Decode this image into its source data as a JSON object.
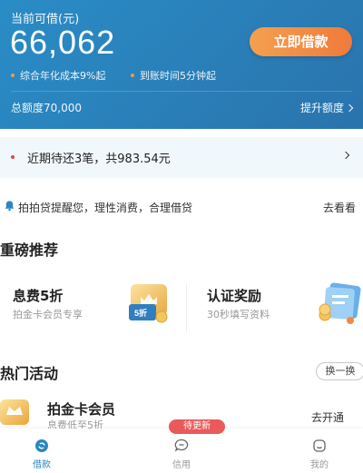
{
  "header": {
    "available_label": "当前可借(元)",
    "available_amount": "66,062",
    "borrow_button": "立即借款",
    "notes": [
      "综合年化成本9%起",
      "到账时间5分钟起"
    ],
    "total_quota": "总额度70,000",
    "raise_quota": "提升额度"
  },
  "repayment": {
    "text": "近期待还3笔，共983.54元"
  },
  "notice": {
    "text": "拍拍贷提醒您，理性消费，合理借贷",
    "action": "去看看"
  },
  "featured": {
    "title": "重磅推荐",
    "cards": [
      {
        "title": "息费5折",
        "subtitle": "拍金卡会员专享",
        "badge": "5折"
      },
      {
        "title": "认证奖励",
        "subtitle": "30秒填写资料"
      }
    ]
  },
  "hot": {
    "title": "热门活动",
    "swap_label": "换一换",
    "item": {
      "title": "拍金卡会员",
      "subtitle": "息费低至5折",
      "action": "去开通"
    }
  },
  "tabbar": {
    "badge": "待更新",
    "tabs": [
      {
        "label": "借款",
        "icon": "loan-icon",
        "active": true
      },
      {
        "label": "信用",
        "icon": "credit-icon",
        "active": false
      },
      {
        "label": "我的",
        "icon": "profile-icon",
        "active": false
      }
    ]
  },
  "colors": {
    "primary": "#2a86c2",
    "accent_orange": "#f28a3f",
    "alert_red": "#e44747"
  }
}
